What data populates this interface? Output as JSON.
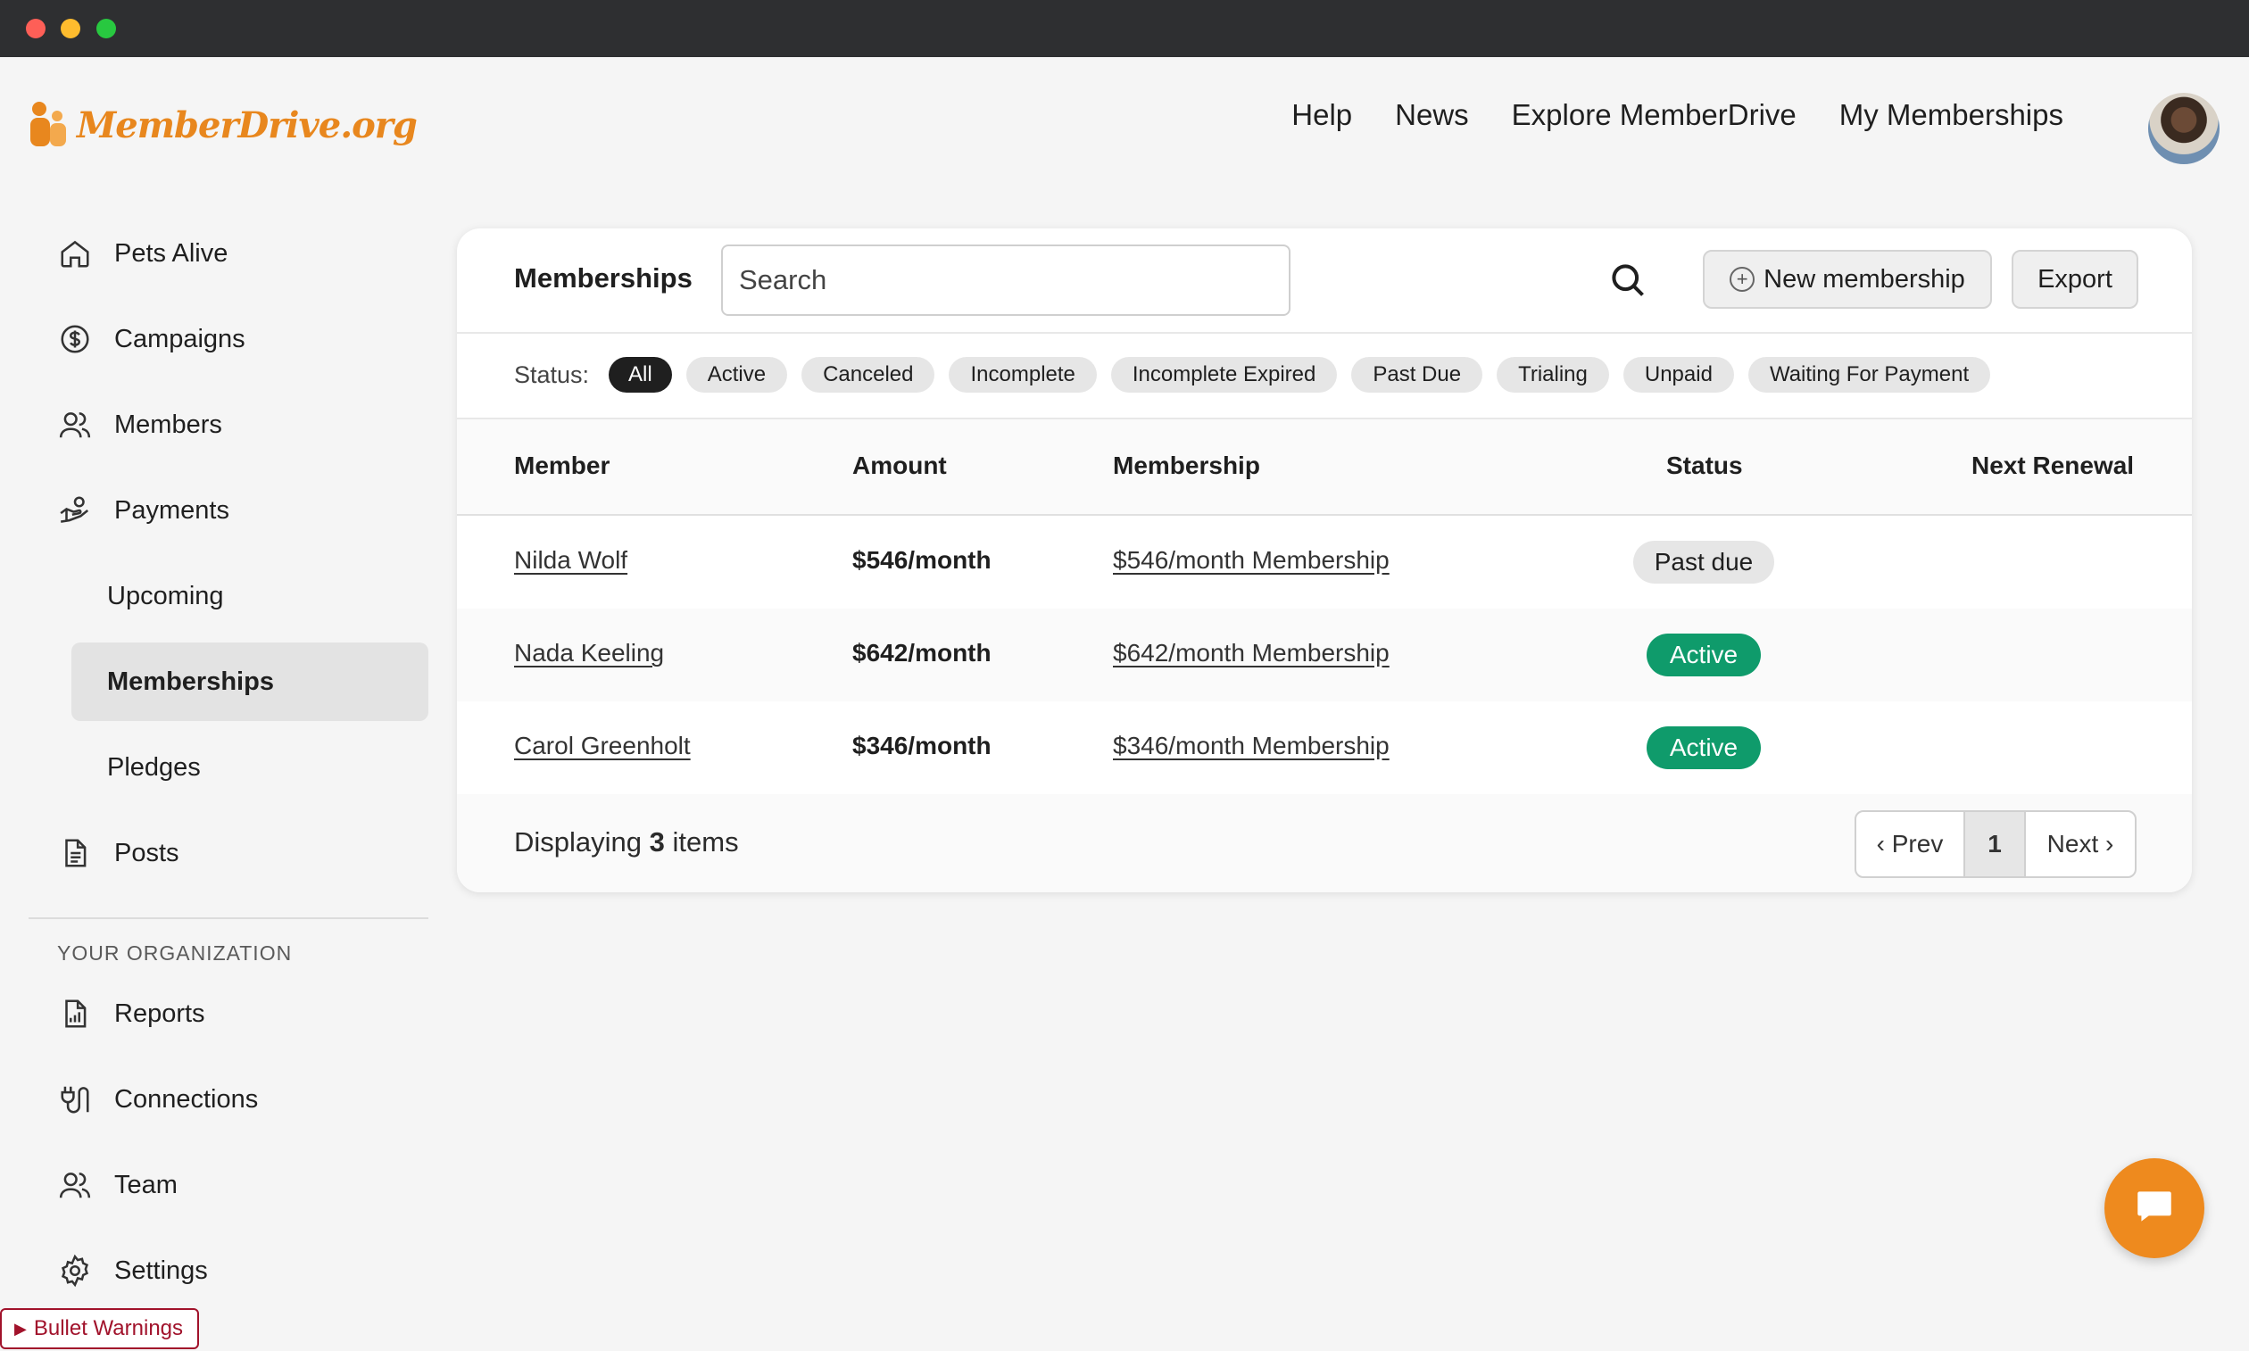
{
  "logo": {
    "text": "MemberDrive.org"
  },
  "topnav": {
    "help": "Help",
    "news": "News",
    "explore": "Explore MemberDrive",
    "my_memberships": "My Memberships"
  },
  "sidebar": {
    "items": [
      {
        "label": "Pets Alive",
        "icon": "home-icon"
      },
      {
        "label": "Campaigns",
        "icon": "dollar-circle-icon"
      },
      {
        "label": "Members",
        "icon": "users-icon"
      },
      {
        "label": "Payments",
        "icon": "hand-coins-icon"
      },
      {
        "label": "Upcoming"
      },
      {
        "label": "Memberships"
      },
      {
        "label": "Pledges"
      },
      {
        "label": "Posts",
        "icon": "document-icon"
      }
    ],
    "section_label": "YOUR ORGANIZATION",
    "org_items": [
      {
        "label": "Reports",
        "icon": "report-icon"
      },
      {
        "label": "Connections",
        "icon": "plug-icon"
      },
      {
        "label": "Team",
        "icon": "users-icon"
      },
      {
        "label": "Settings",
        "icon": "gear-icon"
      }
    ]
  },
  "bullet_warnings": "Bullet Warnings",
  "card": {
    "title": "Memberships",
    "search_placeholder": "Search",
    "new_button": "New membership",
    "export_button": "Export",
    "status_label": "Status:",
    "filters": [
      "All",
      "Active",
      "Canceled",
      "Incomplete",
      "Incomplete Expired",
      "Past Due",
      "Trialing",
      "Unpaid",
      "Waiting For Payment"
    ],
    "selected_filter": "All",
    "columns": [
      "Member",
      "Amount",
      "Membership",
      "Status",
      "Next Renewal"
    ],
    "rows": [
      {
        "member": "Nilda Wolf",
        "amount": "$546/month",
        "membership": "$546/month Membership",
        "status": "Past due"
      },
      {
        "member": "Nada Keeling",
        "amount": "$642/month",
        "membership": "$642/month Membership",
        "status": "Active"
      },
      {
        "member": "Carol Greenholt",
        "amount": "$346/month",
        "membership": "$346/month Membership",
        "status": "Active"
      }
    ],
    "footer": {
      "prefix": "Displaying",
      "count": "3",
      "suffix": "items"
    },
    "pager": {
      "prev": "‹ Prev",
      "page": "1",
      "next": "Next ›"
    }
  },
  "colors": {
    "brand": "#e8871e",
    "active_badge": "#0f9b6b",
    "chip_selected": "#1f1f1f",
    "warning": "#a1122b"
  }
}
